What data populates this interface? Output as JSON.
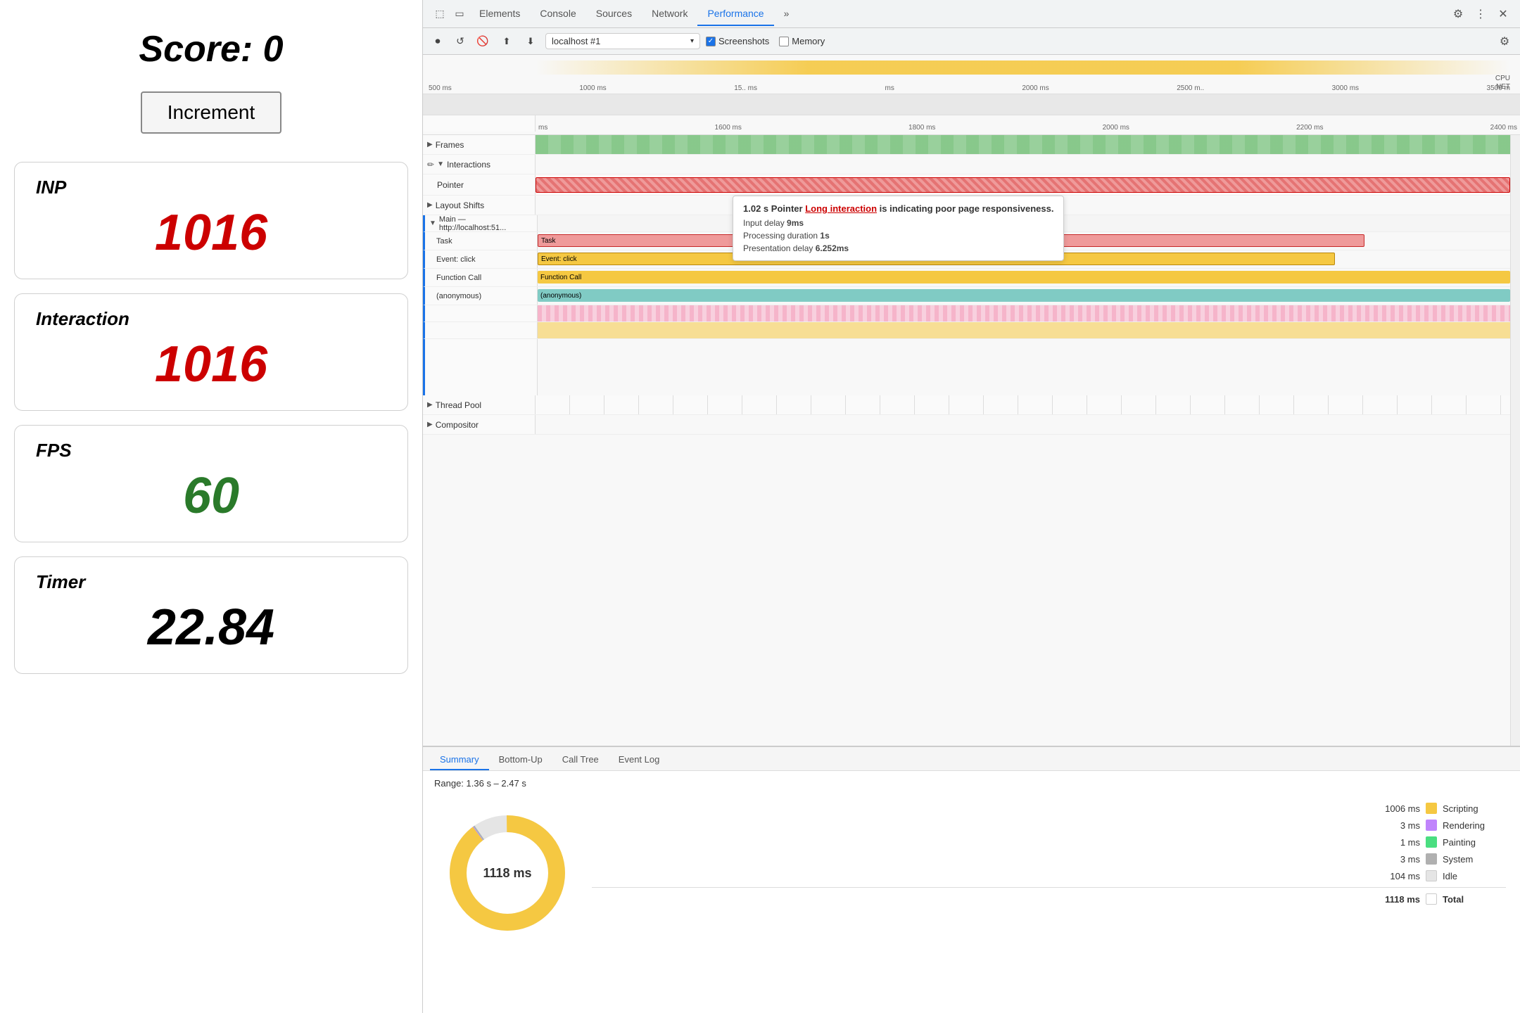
{
  "leftPanel": {
    "scoreTitle": "Score: 0",
    "incrementBtn": "Increment",
    "metrics": [
      {
        "label": "INP",
        "value": "1016",
        "color": "red"
      },
      {
        "label": "Interaction",
        "value": "1016",
        "color": "red"
      },
      {
        "label": "FPS",
        "value": "60",
        "color": "green"
      },
      {
        "label": "Timer",
        "value": "22.84",
        "color": "black"
      }
    ]
  },
  "devtools": {
    "tabs": [
      {
        "label": "Elements",
        "active": false
      },
      {
        "label": "Console",
        "active": false
      },
      {
        "label": "Sources",
        "active": false
      },
      {
        "label": "Network",
        "active": false
      },
      {
        "label": "Performance",
        "active": true
      },
      {
        "label": "»",
        "active": false
      }
    ],
    "icons": {
      "settings": "⚙",
      "more": "⋮",
      "close": "✕"
    },
    "recordBar": {
      "recordIcon": "⏺",
      "refreshIcon": "↺",
      "stopIcon": "🚫",
      "uploadIcon": "↑",
      "downloadIcon": "↓",
      "urlText": "localhost #1",
      "screenshots": "Screenshots",
      "memory": "Memory",
      "settingsIcon": "⚙"
    },
    "timeline": {
      "rulerTimes": [
        "500 ms",
        "1000 ms",
        "15.. ms",
        "ms",
        "2000 ms",
        "2500 m..",
        "3000 ms",
        "3500 m"
      ],
      "zoomTimes": [
        "ms",
        "1600 ms",
        "1800 ms",
        "2000 ms",
        "2200 ms",
        "2400 ms"
      ],
      "tracks": [
        {
          "name": "Frames",
          "type": "frames"
        },
        {
          "name": "Interactions",
          "type": "interactions",
          "hasChevron": true
        },
        {
          "name": "Pointer",
          "type": "pointer-bar"
        },
        {
          "name": "Layout Shifts",
          "type": "layout-shifts",
          "hasChevron": true
        }
      ],
      "mainTrack": {
        "label": "Main — http://localhost:51...",
        "rows": [
          {
            "name": "Task",
            "color": "#ef9a9a",
            "borderColor": "#c62828"
          },
          {
            "name": "Event: click",
            "color": "#f5c842"
          },
          {
            "name": "Function Call",
            "color": "#f5c842"
          },
          {
            "name": "(anonymous)",
            "color": "#80cbc4"
          }
        ]
      },
      "threadPool": {
        "label": "Thread Pool"
      },
      "compositor": {
        "label": "Compositor"
      }
    },
    "tooltip": {
      "time": "1.02 s",
      "type": "Pointer",
      "linkText": "Long interaction",
      "message": " is indicating poor page responsiveness.",
      "inputDelay": "9ms",
      "processingDuration": "1s",
      "presentationDelay": "6.252ms"
    },
    "bottomPanel": {
      "tabs": [
        "Summary",
        "Bottom-Up",
        "Call Tree",
        "Event Log"
      ],
      "activeTab": "Summary",
      "range": "Range: 1.36 s – 2.47 s",
      "donutLabel": "1118 ms",
      "legend": [
        {
          "ms": "1006 ms",
          "color": "#f5c842",
          "label": "Scripting"
        },
        {
          "ms": "3 ms",
          "color": "#c084fc",
          "label": "Rendering"
        },
        {
          "ms": "1 ms",
          "color": "#4ade80",
          "label": "Painting"
        },
        {
          "ms": "3 ms",
          "color": "#b0b0b0",
          "label": "System"
        },
        {
          "ms": "104 ms",
          "color": "#e5e5e5",
          "label": "Idle"
        },
        {
          "ms": "1118 ms",
          "color": "#fff",
          "label": "Total",
          "bold": true
        }
      ]
    }
  }
}
